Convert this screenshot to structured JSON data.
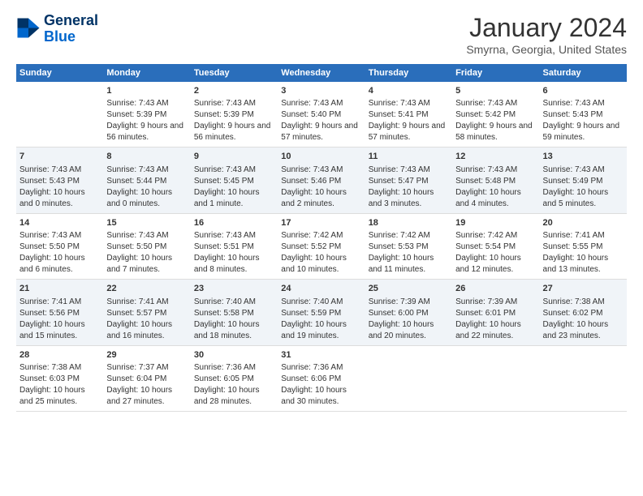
{
  "logo": {
    "line1": "General",
    "line2": "Blue"
  },
  "title": "January 2024",
  "subtitle": "Smyrna, Georgia, United States",
  "colors": {
    "header_bg": "#2a6ebb",
    "row_even": "#f0f4f8",
    "row_odd": "#ffffff"
  },
  "weekdays": [
    "Sunday",
    "Monday",
    "Tuesday",
    "Wednesday",
    "Thursday",
    "Friday",
    "Saturday"
  ],
  "weeks": [
    [
      {
        "day": "",
        "sunrise": "",
        "sunset": "",
        "daylight": ""
      },
      {
        "day": "1",
        "sunrise": "Sunrise: 7:43 AM",
        "sunset": "Sunset: 5:39 PM",
        "daylight": "Daylight: 9 hours and 56 minutes."
      },
      {
        "day": "2",
        "sunrise": "Sunrise: 7:43 AM",
        "sunset": "Sunset: 5:39 PM",
        "daylight": "Daylight: 9 hours and 56 minutes."
      },
      {
        "day": "3",
        "sunrise": "Sunrise: 7:43 AM",
        "sunset": "Sunset: 5:40 PM",
        "daylight": "Daylight: 9 hours and 57 minutes."
      },
      {
        "day": "4",
        "sunrise": "Sunrise: 7:43 AM",
        "sunset": "Sunset: 5:41 PM",
        "daylight": "Daylight: 9 hours and 57 minutes."
      },
      {
        "day": "5",
        "sunrise": "Sunrise: 7:43 AM",
        "sunset": "Sunset: 5:42 PM",
        "daylight": "Daylight: 9 hours and 58 minutes."
      },
      {
        "day": "6",
        "sunrise": "Sunrise: 7:43 AM",
        "sunset": "Sunset: 5:43 PM",
        "daylight": "Daylight: 9 hours and 59 minutes."
      }
    ],
    [
      {
        "day": "7",
        "sunrise": "Sunrise: 7:43 AM",
        "sunset": "Sunset: 5:43 PM",
        "daylight": "Daylight: 10 hours and 0 minutes."
      },
      {
        "day": "8",
        "sunrise": "Sunrise: 7:43 AM",
        "sunset": "Sunset: 5:44 PM",
        "daylight": "Daylight: 10 hours and 0 minutes."
      },
      {
        "day": "9",
        "sunrise": "Sunrise: 7:43 AM",
        "sunset": "Sunset: 5:45 PM",
        "daylight": "Daylight: 10 hours and 1 minute."
      },
      {
        "day": "10",
        "sunrise": "Sunrise: 7:43 AM",
        "sunset": "Sunset: 5:46 PM",
        "daylight": "Daylight: 10 hours and 2 minutes."
      },
      {
        "day": "11",
        "sunrise": "Sunrise: 7:43 AM",
        "sunset": "Sunset: 5:47 PM",
        "daylight": "Daylight: 10 hours and 3 minutes."
      },
      {
        "day": "12",
        "sunrise": "Sunrise: 7:43 AM",
        "sunset": "Sunset: 5:48 PM",
        "daylight": "Daylight: 10 hours and 4 minutes."
      },
      {
        "day": "13",
        "sunrise": "Sunrise: 7:43 AM",
        "sunset": "Sunset: 5:49 PM",
        "daylight": "Daylight: 10 hours and 5 minutes."
      }
    ],
    [
      {
        "day": "14",
        "sunrise": "Sunrise: 7:43 AM",
        "sunset": "Sunset: 5:50 PM",
        "daylight": "Daylight: 10 hours and 6 minutes."
      },
      {
        "day": "15",
        "sunrise": "Sunrise: 7:43 AM",
        "sunset": "Sunset: 5:50 PM",
        "daylight": "Daylight: 10 hours and 7 minutes."
      },
      {
        "day": "16",
        "sunrise": "Sunrise: 7:43 AM",
        "sunset": "Sunset: 5:51 PM",
        "daylight": "Daylight: 10 hours and 8 minutes."
      },
      {
        "day": "17",
        "sunrise": "Sunrise: 7:42 AM",
        "sunset": "Sunset: 5:52 PM",
        "daylight": "Daylight: 10 hours and 10 minutes."
      },
      {
        "day": "18",
        "sunrise": "Sunrise: 7:42 AM",
        "sunset": "Sunset: 5:53 PM",
        "daylight": "Daylight: 10 hours and 11 minutes."
      },
      {
        "day": "19",
        "sunrise": "Sunrise: 7:42 AM",
        "sunset": "Sunset: 5:54 PM",
        "daylight": "Daylight: 10 hours and 12 minutes."
      },
      {
        "day": "20",
        "sunrise": "Sunrise: 7:41 AM",
        "sunset": "Sunset: 5:55 PM",
        "daylight": "Daylight: 10 hours and 13 minutes."
      }
    ],
    [
      {
        "day": "21",
        "sunrise": "Sunrise: 7:41 AM",
        "sunset": "Sunset: 5:56 PM",
        "daylight": "Daylight: 10 hours and 15 minutes."
      },
      {
        "day": "22",
        "sunrise": "Sunrise: 7:41 AM",
        "sunset": "Sunset: 5:57 PM",
        "daylight": "Daylight: 10 hours and 16 minutes."
      },
      {
        "day": "23",
        "sunrise": "Sunrise: 7:40 AM",
        "sunset": "Sunset: 5:58 PM",
        "daylight": "Daylight: 10 hours and 18 minutes."
      },
      {
        "day": "24",
        "sunrise": "Sunrise: 7:40 AM",
        "sunset": "Sunset: 5:59 PM",
        "daylight": "Daylight: 10 hours and 19 minutes."
      },
      {
        "day": "25",
        "sunrise": "Sunrise: 7:39 AM",
        "sunset": "Sunset: 6:00 PM",
        "daylight": "Daylight: 10 hours and 20 minutes."
      },
      {
        "day": "26",
        "sunrise": "Sunrise: 7:39 AM",
        "sunset": "Sunset: 6:01 PM",
        "daylight": "Daylight: 10 hours and 22 minutes."
      },
      {
        "day": "27",
        "sunrise": "Sunrise: 7:38 AM",
        "sunset": "Sunset: 6:02 PM",
        "daylight": "Daylight: 10 hours and 23 minutes."
      }
    ],
    [
      {
        "day": "28",
        "sunrise": "Sunrise: 7:38 AM",
        "sunset": "Sunset: 6:03 PM",
        "daylight": "Daylight: 10 hours and 25 minutes."
      },
      {
        "day": "29",
        "sunrise": "Sunrise: 7:37 AM",
        "sunset": "Sunset: 6:04 PM",
        "daylight": "Daylight: 10 hours and 27 minutes."
      },
      {
        "day": "30",
        "sunrise": "Sunrise: 7:36 AM",
        "sunset": "Sunset: 6:05 PM",
        "daylight": "Daylight: 10 hours and 28 minutes."
      },
      {
        "day": "31",
        "sunrise": "Sunrise: 7:36 AM",
        "sunset": "Sunset: 6:06 PM",
        "daylight": "Daylight: 10 hours and 30 minutes."
      },
      {
        "day": "",
        "sunrise": "",
        "sunset": "",
        "daylight": ""
      },
      {
        "day": "",
        "sunrise": "",
        "sunset": "",
        "daylight": ""
      },
      {
        "day": "",
        "sunrise": "",
        "sunset": "",
        "daylight": ""
      }
    ]
  ]
}
